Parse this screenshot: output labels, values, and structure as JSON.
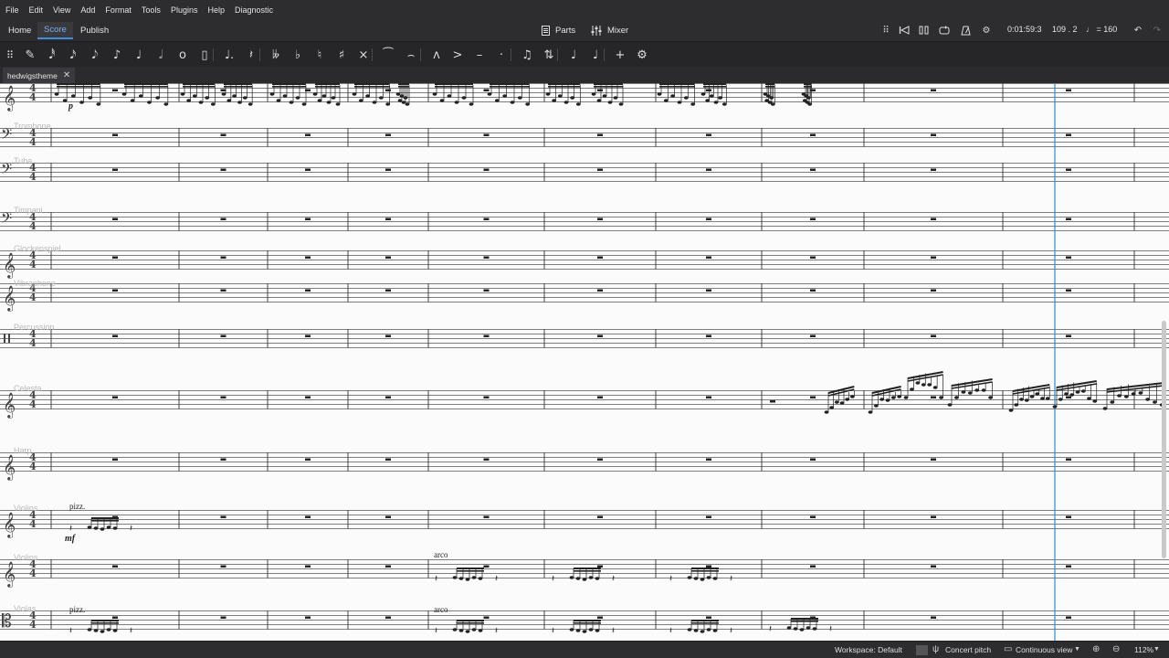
{
  "menu": [
    "File",
    "Edit",
    "View",
    "Add",
    "Format",
    "Tools",
    "Plugins",
    "Help",
    "Diagnostic"
  ],
  "tabs": {
    "home": "Home",
    "score": "Score",
    "publish": "Publish"
  },
  "center": {
    "parts": "Parts",
    "mixer": "Mixer"
  },
  "playback": {
    "time": "0:01:59:3",
    "position": "109 . 2",
    "tempo": "♩ = 160"
  },
  "toolbar": [
    {
      "name": "input-mode-pen-icon",
      "glyph": "✎"
    },
    {
      "name": "note-64th-icon",
      "glyph": "𝅘𝅥𝅰"
    },
    {
      "name": "note-32nd-icon",
      "glyph": "𝅘𝅥𝅯"
    },
    {
      "name": "note-16th-icon",
      "glyph": "𝅘𝅥𝅮"
    },
    {
      "name": "note-eighth-icon",
      "glyph": "♪"
    },
    {
      "name": "note-quarter-icon",
      "glyph": "♩"
    },
    {
      "name": "note-half-icon",
      "glyph": "𝅗𝅥"
    },
    {
      "name": "note-whole-icon",
      "glyph": "o"
    },
    {
      "name": "note-breve-icon",
      "glyph": "▯"
    },
    {
      "name": "augmentation-dot-icon",
      "glyph": "♩."
    },
    {
      "name": "rest-icon",
      "glyph": "𝄽"
    },
    {
      "name": "double-flat-icon",
      "glyph": "𝄫"
    },
    {
      "name": "flat-icon",
      "glyph": "♭"
    },
    {
      "name": "natural-icon",
      "glyph": "♮"
    },
    {
      "name": "sharp-icon",
      "glyph": "♯"
    },
    {
      "name": "double-sharp-icon",
      "glyph": "×"
    },
    {
      "name": "tie-icon",
      "glyph": "⁀"
    },
    {
      "name": "slur-icon",
      "glyph": "⌢"
    },
    {
      "name": "marcato-icon",
      "glyph": "ʌ"
    },
    {
      "name": "accent-icon",
      "glyph": ">"
    },
    {
      "name": "tenuto-icon",
      "glyph": "–"
    },
    {
      "name": "staccato-icon",
      "glyph": "·"
    },
    {
      "name": "tuplet-icon",
      "glyph": "♫"
    },
    {
      "name": "flip-direction-icon",
      "glyph": "⇅"
    },
    {
      "name": "voice-1-icon",
      "glyph": "♩"
    },
    {
      "name": "voice-2-icon",
      "glyph": "♩"
    },
    {
      "name": "add-icon",
      "glyph": "+"
    },
    {
      "name": "customize-toolbar-gear-icon",
      "glyph": "⚙"
    }
  ],
  "document": {
    "tab_name": "hedwigstheme"
  },
  "instruments": [
    "Trombone",
    "Tuba",
    "Timpani",
    "Glockenspiel",
    "Vibraphone",
    "Percussion",
    "Celesta",
    "Harp",
    "Violins",
    "Violins",
    "Violas"
  ],
  "expressions": {
    "pizz": "pizz.",
    "arco": "arco"
  },
  "dynamics": {
    "p": "p",
    "mf": "mf"
  },
  "status": {
    "workspace": "Workspace: Default",
    "concert_pitch": "Concert pitch",
    "view_mode": "Continuous view",
    "zoom": "112%"
  }
}
